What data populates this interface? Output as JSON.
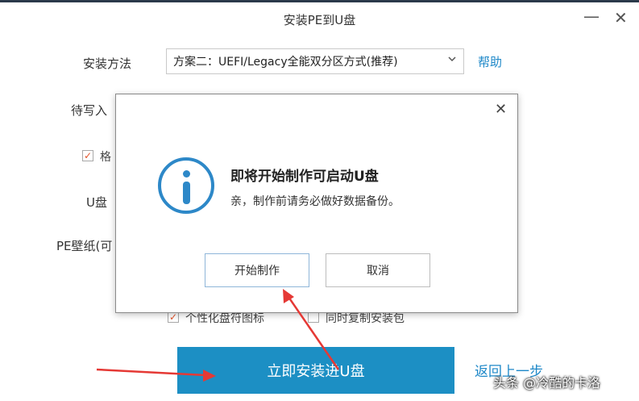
{
  "window": {
    "title": "安装PE到U盘",
    "minimize_glyph": "—",
    "close_glyph": "✕"
  },
  "form": {
    "install_method_label": "安装方法",
    "install_method_value": "方案二：UEFI/Legacy全能双分区方式(推荐)",
    "help_label": "帮助",
    "target_label_partial": "待写入",
    "format_label_partial": "格",
    "usb_label_partial": "U盘",
    "wallpaper_label_partial": "PE壁纸(可",
    "personalize_icon_label": "个性化盘符图标",
    "copy_package_label": "同时复制安装包",
    "check_mark": "✓"
  },
  "buttons": {
    "install_now": "立即安装进U盘",
    "go_back": "返回上一步"
  },
  "dialog": {
    "close_glyph": "✕",
    "heading": "即将开始制作可启动U盘",
    "message": "亲，制作前请务必做好数据备份。",
    "start_button": "开始制作",
    "cancel_button": "取消"
  },
  "watermark": "头条 @冷酷的卡洛",
  "colors": {
    "accent": "#1c8fc4",
    "link": "#1e88c8",
    "annotation_arrow": "#e53935",
    "checkbox_mark": "#e2542b"
  },
  "icons": {
    "dialog_info": "info-icon",
    "select_chevron": "chevron-down-icon"
  }
}
